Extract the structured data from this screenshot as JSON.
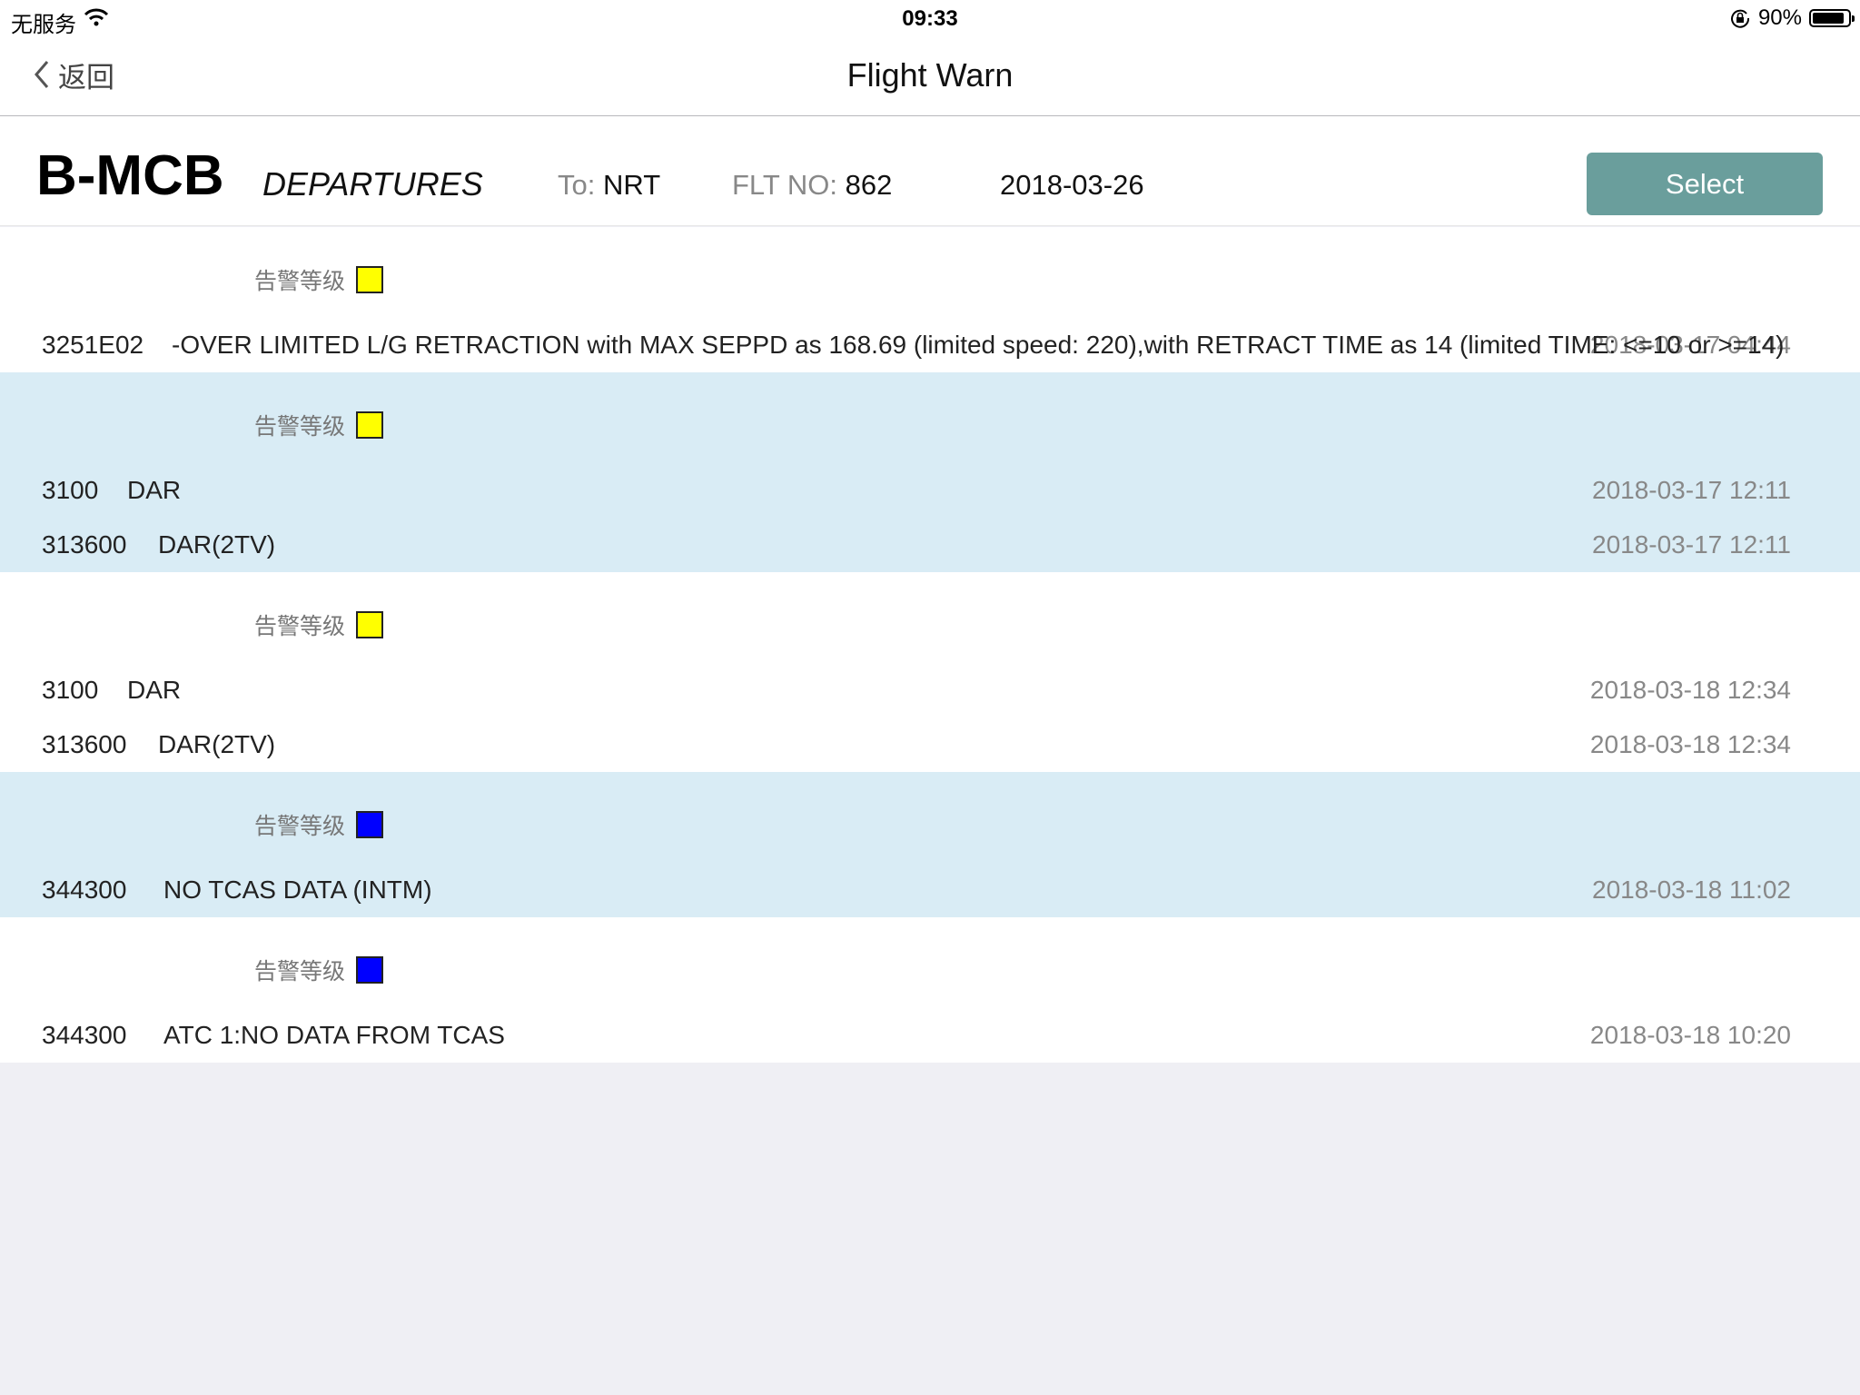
{
  "status_bar": {
    "carrier": "无服务",
    "time": "09:33",
    "battery": "90%",
    "battery_level": 0.9
  },
  "nav": {
    "back_label": "返回",
    "title": "Flight Warn"
  },
  "info": {
    "registration": "B-MCB",
    "direction": "DEPARTURES",
    "to_label": "To:",
    "to_value": "NRT",
    "flt_label": "FLT NO:",
    "flt_value": "862",
    "date": "2018-03-26",
    "select_label": "Select"
  },
  "level_label": "告警等级",
  "colors": {
    "yellow": "#ffff00",
    "blue": "#0000ff",
    "row_blue": "#d9ecf5",
    "select_button": "#6a9e9c"
  },
  "groups": [
    {
      "level_color": "yellow",
      "rows": [
        {
          "code": "3251E02",
          "desc": "-OVER LIMITED L/G RETRACTION with MAX SEPPD as 168.69 (limited speed: 220),with RETRACT TIME as 14  (limited TIME: <=10 or >=14)",
          "time": "2018-03-17 04:44"
        }
      ]
    },
    {
      "level_color": "yellow",
      "rows": [
        {
          "code": "3100",
          "desc": "DAR",
          "time": "2018-03-17 12:11"
        },
        {
          "code": "313600",
          "desc": "DAR(2TV)",
          "time": "2018-03-17 12:11"
        }
      ]
    },
    {
      "level_color": "yellow",
      "rows": [
        {
          "code": "3100",
          "desc": "DAR",
          "time": "2018-03-18 12:34"
        },
        {
          "code": "313600",
          "desc": "DAR(2TV)",
          "time": "2018-03-18 12:34"
        }
      ]
    },
    {
      "level_color": "blue",
      "rows": [
        {
          "code": "344300",
          "desc": "NO TCAS DATA (INTM)",
          "time": "2018-03-18 11:02"
        }
      ]
    },
    {
      "level_color": "blue",
      "rows": [
        {
          "code": "344300",
          "desc": "ATC 1:NO DATA FROM TCAS",
          "time": "2018-03-18 10:20"
        }
      ]
    }
  ]
}
